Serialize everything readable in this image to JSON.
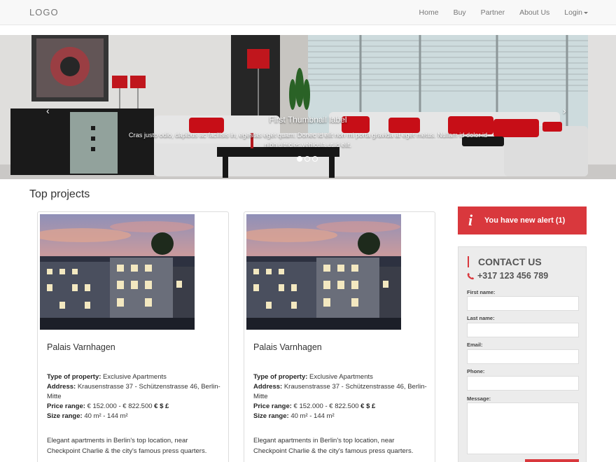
{
  "navbar": {
    "logo": "LOGO",
    "items": [
      {
        "label": "Home"
      },
      {
        "label": "Buy"
      },
      {
        "label": "Partner"
      },
      {
        "label": "About Us"
      },
      {
        "label": "Login"
      }
    ]
  },
  "carousel": {
    "prev_icon": "‹",
    "next_icon": "›",
    "title": "First Thumbnail label",
    "text": "Cras justo odio, dapibus ac facilisis in, egestas eget quam. Donec id elit non mi porta gravida at eget metus. Nullam id dolor id nibh ultricies vehicula ut id elit.",
    "active_index": 0,
    "slide_count": 3
  },
  "projects": {
    "title": "Top projects",
    "cards": [
      {
        "name": "Palais Varnhagen",
        "type_label": "Type of property:",
        "type_value": " Exclusive Apartments",
        "address_label": "Address:",
        "address_value": " Krausenstrasse 37 - Schützenstrasse 46, Berlin-Mitte",
        "price_label": "Price range:",
        "price_value": " € 152.000 - € 822.500 ",
        "currency": "€ $ £",
        "size_label": "Size range:",
        "size_value": " 40 m² - 144 m²",
        "description": "Elegant apartments in Berlin's top location, near Checkpoint Charlie & the city's famous press quarters."
      },
      {
        "name": "Palais Varnhagen",
        "type_label": "Type of property:",
        "type_value": " Exclusive Apartments",
        "address_label": "Address:",
        "address_value": " Krausenstrasse 37 - Schützenstrasse 46, Berlin-Mitte",
        "price_label": "Price range:",
        "price_value": " € 152.000 - € 822.500 ",
        "currency": "€ $ £",
        "size_label": "Size range:",
        "size_value": " 40 m² - 144 m²",
        "description": "Elegant apartments in Berlin's top location, near Checkpoint Charlie & the city's famous press quarters."
      }
    ]
  },
  "alert": {
    "icon": "i",
    "text": "You have new alert (1)"
  },
  "contact": {
    "title": "CONTACT US",
    "phone": "+317 123 456 789",
    "fields": {
      "first_name": "First name:",
      "last_name": "Last name:",
      "email": "Email:",
      "phone": "Phone:",
      "message": "Message:"
    }
  },
  "colors": {
    "accent": "#d9383d",
    "navbar_bg": "#f8f8f8",
    "panel_bg": "#ececec"
  }
}
